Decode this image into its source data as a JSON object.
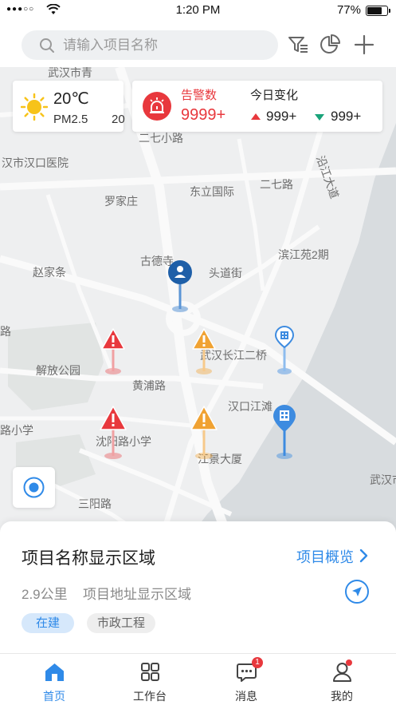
{
  "status_bar": {
    "carrier": "●●●○○",
    "time": "1:20 PM",
    "battery": "77%",
    "battery_level": 0.77
  },
  "search": {
    "placeholder": "请输入项目名称"
  },
  "top_icons": [
    "filter-icon",
    "pie-chart-icon",
    "plus-icon"
  ],
  "weather": {
    "temperature": "20℃",
    "pm_label": "PM2.5",
    "pm_value": "20",
    "icon": "sun-icon"
  },
  "alarm": {
    "title": "告警数",
    "count": "9999+",
    "change_title": "今日变化",
    "up_value": "999+",
    "down_value": "999+",
    "colors": {
      "alarm": "#e8383d",
      "down": "#1aa37a"
    }
  },
  "map": {
    "labels": {
      "l1": "武汉市青",
      "l2": "二七小路",
      "l3": "汉市汉口医院",
      "l4": "东立国际",
      "l5": "二七路",
      "l6": "沿江大道",
      "l7": "罗家庄",
      "l8": "滨江苑2期",
      "l9": "古德寺",
      "l10": "赵家条",
      "l11": "头道街",
      "l12": "路",
      "l13": "解放公园",
      "l14": "武汉长江二桥",
      "l15": "黄浦路",
      "l16": "汉口江滩",
      "l17": "路小学",
      "l18": "沈阳路小学",
      "l19": "江景大厦",
      "l20": "武汉市",
      "l21": "三阳路"
    }
  },
  "info_panel": {
    "project_name": "项目名称显示区域",
    "overview_link": "项目概览",
    "distance": "2.9公里",
    "address": "项目地址显示区域",
    "status_tag": "在建",
    "type_tag": "市政工程"
  },
  "tabs": [
    {
      "label": "首页",
      "icon": "home-icon",
      "active": true
    },
    {
      "label": "工作台",
      "icon": "grid-icon",
      "active": false
    },
    {
      "label": "消息",
      "icon": "message-icon",
      "active": false,
      "badge": "1"
    },
    {
      "label": "我的",
      "icon": "user-icon",
      "active": false,
      "dot": true
    }
  ],
  "accent_color": "#2f8ae8"
}
